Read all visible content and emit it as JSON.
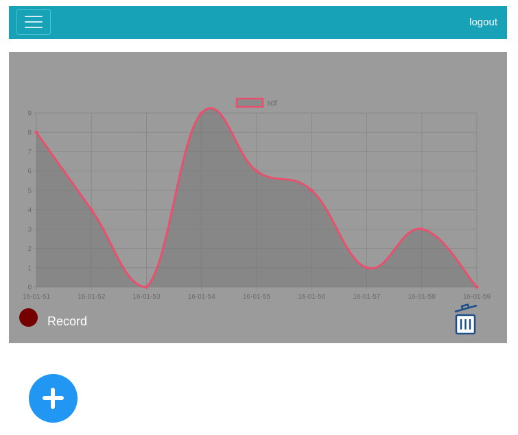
{
  "header": {
    "menu_icon": "hamburger-menu-icon",
    "logout_label": "logout",
    "background": "#17a2b8"
  },
  "chart_data": {
    "type": "line",
    "categories": [
      "16-01-51",
      "16-01-52",
      "16-01-53",
      "16-01-54",
      "16-01-55",
      "16-01-56",
      "16-01-57",
      "16-01-58",
      "16-01-59"
    ],
    "series": [
      {
        "name": "sdf",
        "values": [
          8,
          4,
          0,
          9,
          6,
          5,
          1,
          3,
          0
        ],
        "color": "#e8506e",
        "fill": true
      }
    ],
    "title": "",
    "xlabel": "",
    "ylabel": "",
    "ylim": [
      0,
      9
    ],
    "yticks": [
      0,
      1,
      2,
      3,
      4,
      5,
      6,
      7,
      8,
      9
    ],
    "grid": true,
    "legend": "top-center",
    "smooth": true
  },
  "record": {
    "label": "Record",
    "color": "#750000"
  },
  "trash_icon": "trash-icon",
  "add_icon": "plus-icon",
  "colors": {
    "panel": "#9b9b9b",
    "fab": "#2196f3",
    "trash": "#1c4f8a"
  }
}
